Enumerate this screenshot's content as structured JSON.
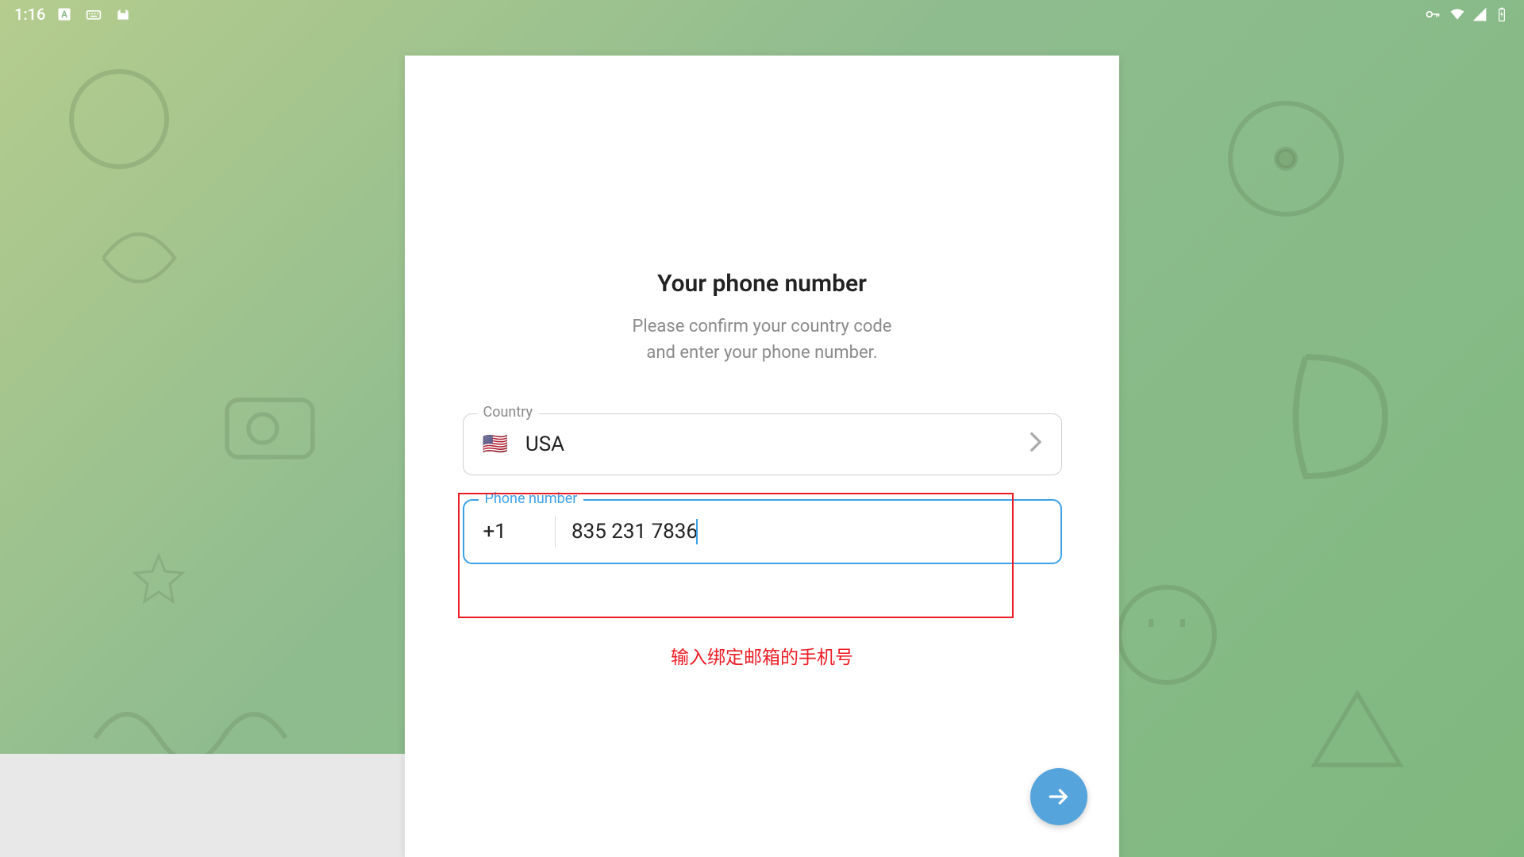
{
  "status_bar": {
    "time": "1:16"
  },
  "card": {
    "title": "Your phone number",
    "subtitle_line1": "Please confirm your country code",
    "subtitle_line2": "and enter your phone number."
  },
  "country_field": {
    "label": "Country",
    "flag": "🇺🇸",
    "name": "USA"
  },
  "phone_field": {
    "label": "Phone number",
    "country_code": "+1",
    "value": "835 231 7836"
  },
  "hint": "输入绑定邮箱的手机号",
  "colors": {
    "accent": "#3ca1e8",
    "error": "#ed1c24",
    "fab": "#56a4dc"
  }
}
